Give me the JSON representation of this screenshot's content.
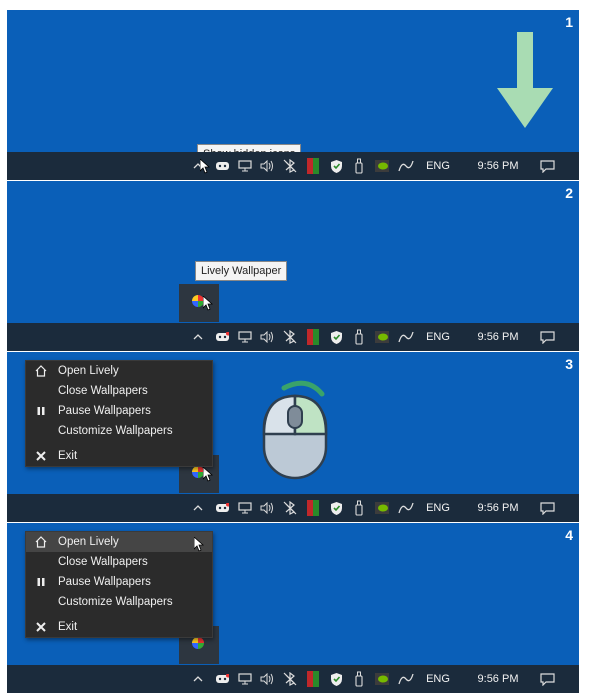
{
  "steps": [
    {
      "number": "1",
      "tooltip": "Show hidden icons"
    },
    {
      "number": "2",
      "tooltip": "Lively Wallpaper"
    },
    {
      "number": "3"
    },
    {
      "number": "4"
    }
  ],
  "taskbar": {
    "language": "ENG",
    "time": "9:56 PM"
  },
  "context_menu": {
    "items": [
      {
        "label": "Open Lively",
        "icon": "home-icon"
      },
      {
        "label": "Close Wallpapers",
        "icon": ""
      },
      {
        "label": "Pause Wallpapers",
        "icon": "pause-icon"
      },
      {
        "label": "Customize Wallpapers",
        "icon": ""
      },
      {
        "label": "Exit",
        "icon": "close-icon"
      }
    ]
  },
  "colors": {
    "desktop": "#0a5fb8",
    "taskbar": "#1b2b3c",
    "arrow": "#a9dcb3",
    "menu": "#2b2b2b"
  }
}
